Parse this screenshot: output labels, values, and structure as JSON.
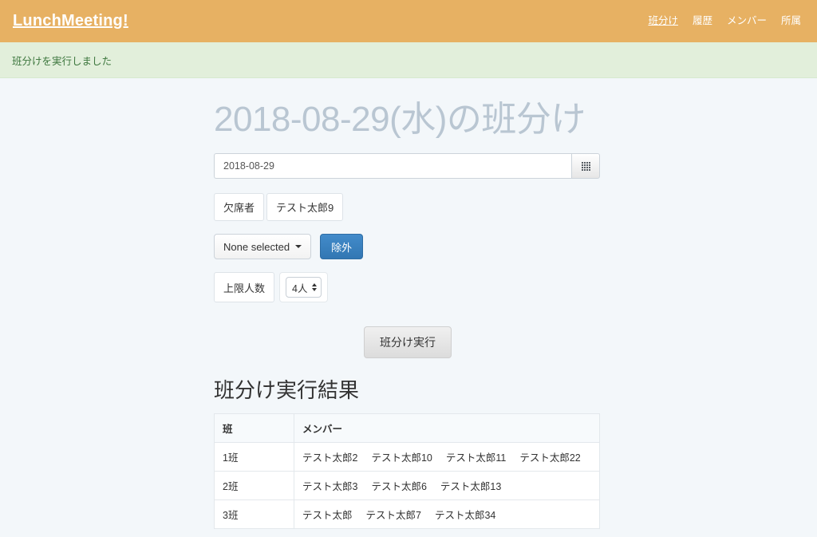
{
  "navbar": {
    "brand": "LunchMeeting!",
    "links": [
      {
        "label": "班分け",
        "active": true
      },
      {
        "label": "履歴",
        "active": false
      },
      {
        "label": "メンバー",
        "active": false
      },
      {
        "label": "所属",
        "active": false
      }
    ],
    "bg_color": "#e7b163",
    "brand_color": "#ffffff"
  },
  "alert": {
    "message": "班分けを実行しました",
    "bg_color": "#e2efdb",
    "text_color": "#3c763d"
  },
  "page": {
    "title": "2018-08-29(水)の班分け",
    "title_color": "#b9c6d2",
    "bg_color": "#f3f7fa"
  },
  "date_field": {
    "value": "2018-08-29",
    "placeholder": "YYYY-MM-DD",
    "calendar_icon": "th-grid-icon"
  },
  "absentee": {
    "label": "欠席者",
    "value": "テスト太郎9"
  },
  "exclude": {
    "dropdown_label": "None selected",
    "dropdown_caret": "caret-down-icon",
    "button_label": "除外",
    "button_color": "#3277b3"
  },
  "capacity": {
    "label": "上限人数",
    "value": "4人",
    "spinner_icon": "up-down-spinner-icon"
  },
  "submit": {
    "label": "班分け実行"
  },
  "result": {
    "heading": "班分け実行結果",
    "columns": [
      "班",
      "メンバー"
    ],
    "rows": [
      {
        "group": "1班",
        "members": [
          "テスト太郎2",
          "テスト太郎10",
          "テスト太郎11",
          "テスト太郎22"
        ]
      },
      {
        "group": "2班",
        "members": [
          "テスト太郎3",
          "テスト太郎6",
          "テスト太郎13"
        ]
      },
      {
        "group": "3班",
        "members": [
          "テスト太郎",
          "テスト太郎7",
          "テスト太郎34"
        ]
      }
    ]
  }
}
